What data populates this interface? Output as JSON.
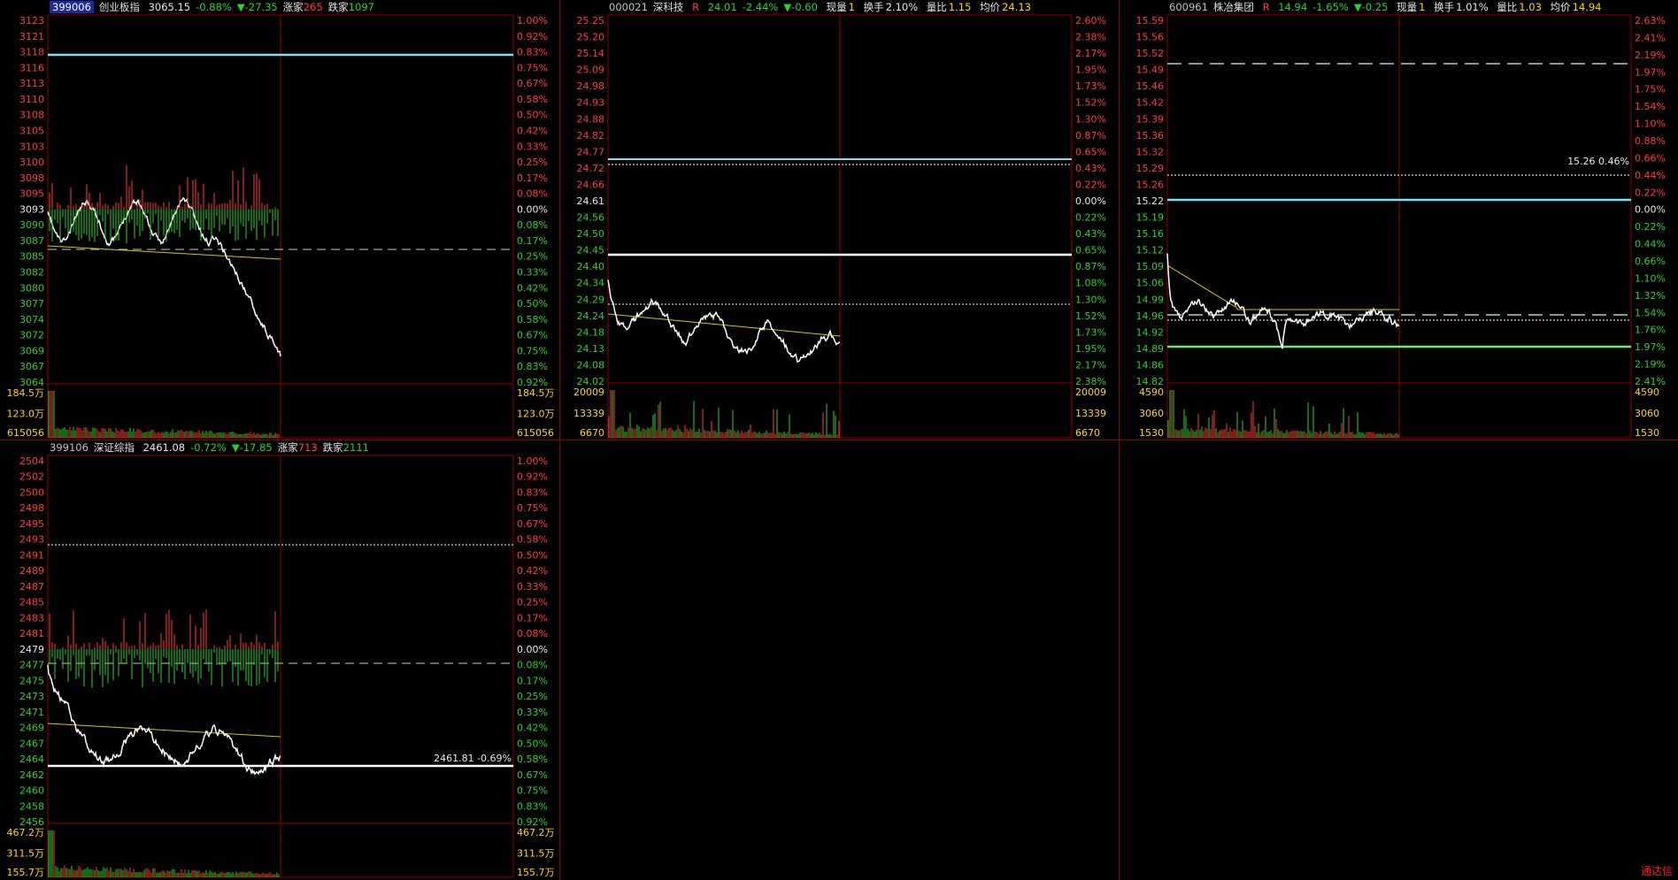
{
  "colors": {
    "up": "#ff3c3c",
    "down": "#2ed02e",
    "grid": "#8b0000",
    "line": "#ffffff",
    "avg": "#d8c800",
    "cyan": "#7fdcf0"
  },
  "panels": [
    {
      "code": "399006",
      "name": "创业板指",
      "price": "3065.15",
      "chg_pct": "-0.88%",
      "chg": "▼-27.35",
      "up_label": "涨家",
      "up_count": "265",
      "down_label": "跌家",
      "down_count": "1097",
      "price_labels": [
        "3123",
        "3121",
        "3118",
        "3116",
        "3113",
        "3110",
        "3108",
        "3105",
        "3103",
        "3100",
        "3098",
        "3095",
        "3093",
        "3090",
        "3087",
        "3085",
        "3082",
        "3080",
        "3077",
        "3074",
        "3072",
        "3069",
        "3067",
        "3064"
      ],
      "pct_labels": [
        "1.00%",
        "0.92%",
        "0.83%",
        "0.75%",
        "0.67%",
        "0.58%",
        "0.50%",
        "0.42%",
        "0.33%",
        "0.25%",
        "0.17%",
        "0.08%",
        "0.00%",
        "0.08%",
        "0.17%",
        "0.25%",
        "0.33%",
        "0.42%",
        "0.50%",
        "0.58%",
        "0.67%",
        "0.75%",
        "0.83%",
        "0.92%"
      ],
      "vol_labels": [
        "184.5万",
        "123.0万",
        "615056"
      ],
      "ref_line": "",
      "series_type": "index"
    },
    {
      "code": "000021",
      "name": "深科技",
      "flag": "R",
      "price": "24.01",
      "chg_pct": "-2.44%",
      "chg": "▼-0.60",
      "fields": [
        {
          "k": "现量",
          "v": "1"
        },
        {
          "k": "换手",
          "v": "2.10%"
        },
        {
          "k": "量比",
          "v": "1.15"
        },
        {
          "k": "均价",
          "v": "24.13"
        }
      ],
      "price_labels": [
        "25.25",
        "25.20",
        "25.14",
        "25.09",
        "24.98",
        "24.93",
        "24.88",
        "24.82",
        "24.77",
        "24.72",
        "24.66",
        "24.61",
        "24.56",
        "24.50",
        "24.45",
        "24.40",
        "24.34",
        "24.29",
        "24.24",
        "24.18",
        "24.13",
        "24.08",
        "24.02"
      ],
      "pct_labels": [
        "2.60%",
        "2.38%",
        "2.17%",
        "1.95%",
        "1.73%",
        "1.52%",
        "1.30%",
        "0.87%",
        "0.65%",
        "0.43%",
        "0.22%",
        "0.00%",
        "0.22%",
        "0.43%",
        "0.65%",
        "0.87%",
        "1.08%",
        "1.30%",
        "1.52%",
        "1.73%",
        "1.95%",
        "2.17%",
        "2.38%"
      ],
      "vol_labels": [
        "20009",
        "13339",
        "6670"
      ],
      "series_type": "stock"
    },
    {
      "code": "600961",
      "name": "株冶集团",
      "flag": "R",
      "price": "14.94",
      "chg_pct": "-1.65%",
      "chg": "▼-0.25",
      "fields": [
        {
          "k": "现量",
          "v": "1"
        },
        {
          "k": "换手",
          "v": "1.01%"
        },
        {
          "k": "量比",
          "v": "1.03"
        },
        {
          "k": "均价",
          "v": "14.94"
        }
      ],
      "price_labels": [
        "15.59",
        "15.56",
        "15.52",
        "15.49",
        "15.46",
        "15.42",
        "15.39",
        "15.36",
        "15.32",
        "15.29",
        "15.26",
        "15.22",
        "15.19",
        "15.16",
        "15.12",
        "15.09",
        "15.06",
        "14.99",
        "14.96",
        "14.92",
        "14.89",
        "14.86",
        "14.82"
      ],
      "pct_labels": [
        "2.63%",
        "2.41%",
        "2.19%",
        "1.97%",
        "1.75%",
        "1.54%",
        "1.10%",
        "0.88%",
        "0.66%",
        "0.44%",
        "0.22%",
        "0.00%",
        "0.22%",
        "0.44%",
        "0.66%",
        "1.10%",
        "1.32%",
        "1.54%",
        "1.76%",
        "1.97%",
        "2.19%",
        "2.41%"
      ],
      "vol_labels": [
        "4590",
        "3060",
        "1530"
      ],
      "annot": "15.26 0.46%",
      "series_type": "stock"
    },
    {
      "code": "399106",
      "name": "深证综指",
      "price": "2461.08",
      "chg_pct": "-0.72%",
      "chg": "▼-17.85",
      "up_label": "涨家",
      "up_count": "713",
      "down_label": "跌家",
      "down_count": "2111",
      "price_labels": [
        "2504",
        "2502",
        "2500",
        "2498",
        "2495",
        "2493",
        "2491",
        "2489",
        "2487",
        "2485",
        "2483",
        "2481",
        "2479",
        "2477",
        "2475",
        "2473",
        "2471",
        "2469",
        "2467",
        "2464",
        "2462",
        "2460",
        "2458",
        "2456"
      ],
      "pct_labels": [
        "1.00%",
        "0.92%",
        "0.83%",
        "0.75%",
        "0.67%",
        "0.58%",
        "0.50%",
        "0.42%",
        "0.33%",
        "0.25%",
        "0.17%",
        "0.08%",
        "0.00%",
        "0.08%",
        "0.17%",
        "0.25%",
        "0.33%",
        "0.42%",
        "0.50%",
        "0.58%",
        "0.67%",
        "0.75%",
        "0.83%",
        "0.92%"
      ],
      "vol_labels": [
        "467.2万",
        "311.5万",
        "155.7万"
      ],
      "annot": "2461.81 -0.69%",
      "series_type": "index"
    }
  ],
  "brand": "通达信"
}
